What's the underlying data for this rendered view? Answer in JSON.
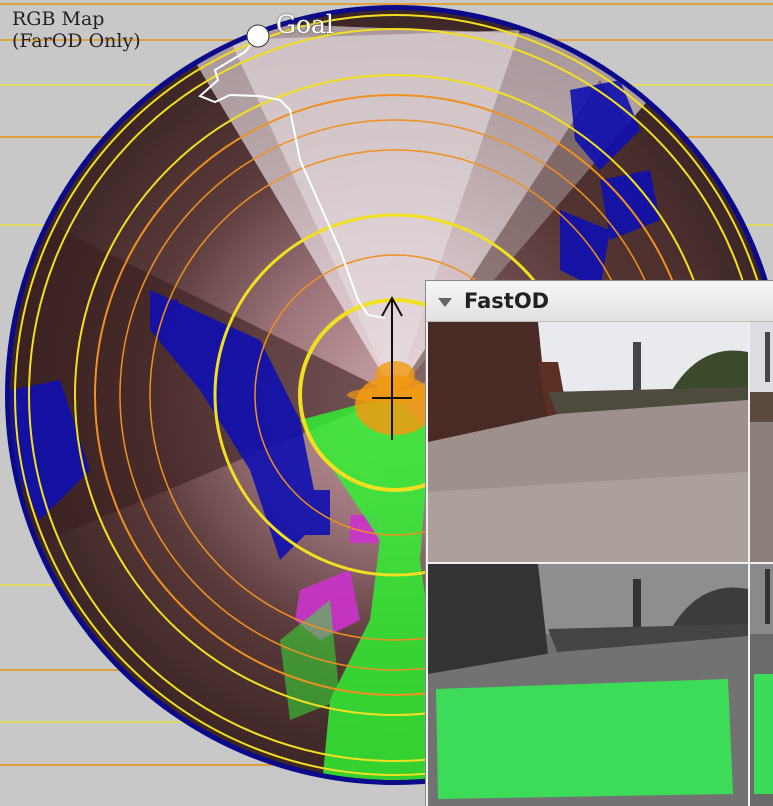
{
  "map": {
    "title_line1": "RGB Map",
    "title_line2": "(FarOD Only)",
    "goal_label": "Goal"
  },
  "fastod_panel": {
    "title": "FastOD"
  },
  "colors": {
    "map_background": "#c8c8c8",
    "outer_ring": "#0a0a8a",
    "yellow_ring": "#f2e020",
    "orange_ring": "#f09020",
    "path": "#ffffff",
    "traversable_overlay": "#33ee33",
    "obstacle_blue": "#1010b0",
    "obstacle_magenta": "#cc33cc",
    "robot_footprint": "#f29a10"
  },
  "icons": {
    "goal_marker": "goal-marker-icon",
    "robot": "robot-crosshair-icon",
    "collapse": "collapse-arrow-icon"
  }
}
